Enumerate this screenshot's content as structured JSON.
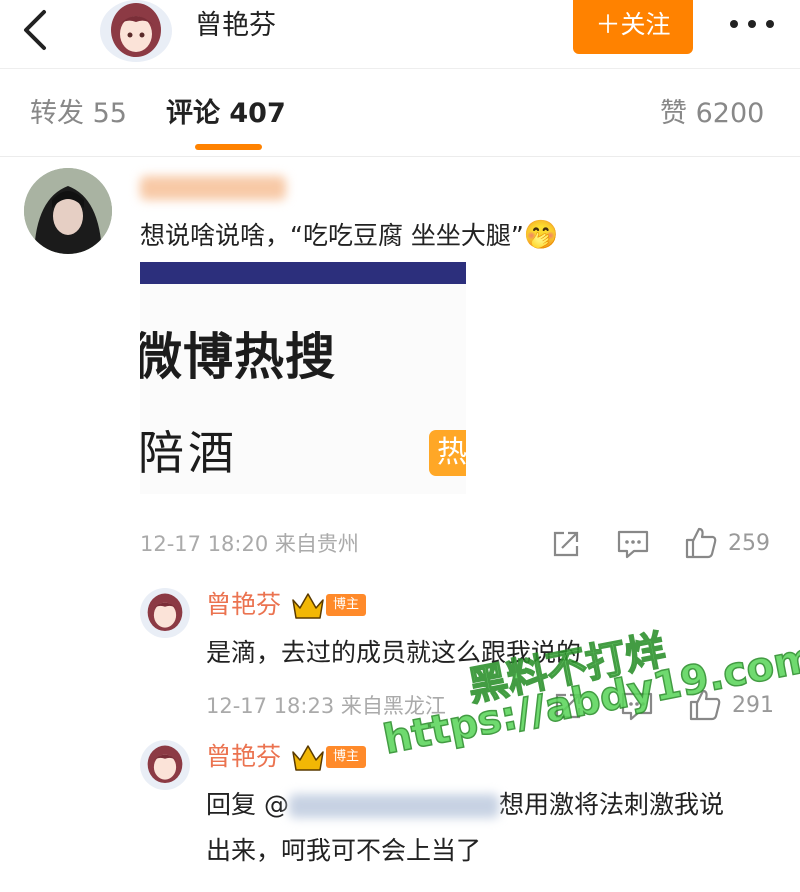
{
  "header": {
    "title": "曾艳芬",
    "follow_label": "＋关注"
  },
  "tabs": [
    {
      "label": "转发 55"
    },
    {
      "label": "评论 407"
    },
    {
      "label": "赞 6200"
    }
  ],
  "comment": {
    "text": "想说啥说啥，“吃吃豆腐 坐坐大腿”",
    "emoji": "🤭",
    "embed": {
      "title": "微博热搜",
      "item": "陪酒",
      "hot_badge": "热"
    },
    "time": "12-17 18:20 来自贵州",
    "likes": "259"
  },
  "replies": [
    {
      "name": "曾艳芬",
      "badge": "博主",
      "text": "是滴，去过的成员就这么跟我说的",
      "time": "12-17 18:23 来自黑龙江",
      "likes": "291"
    },
    {
      "name": "曾艳芬",
      "badge": "博主",
      "text_line1_prefix": "回复 @",
      "text_line1_suffix": "想用激将法刺激我说",
      "text_line2": "出来，呵我可不会上当了"
    }
  ],
  "watermark": {
    "line1": "黑料不打烊",
    "line2": "https://abdy19.com"
  },
  "colors": {
    "accent": "#ff8200",
    "username": "#eb7350",
    "hot": "#ffa726",
    "embed_bar": "#2c2f7c"
  }
}
